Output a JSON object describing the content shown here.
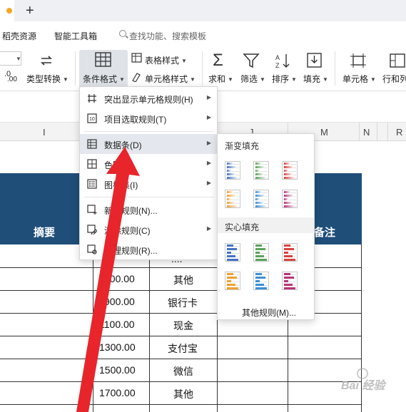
{
  "menu": {
    "item1": "稻壳资源",
    "item2": "智能工具箱",
    "search_placeholder": "查找功能、搜索模板"
  },
  "ribbon": {
    "left_value": ".0",
    "left_value2": ".00",
    "type_convert": "类型转换",
    "cond_format": "条件格式",
    "table_style": "表格样式",
    "cell_style": "单元格样式",
    "sum": "求和",
    "filter": "筛选",
    "sort": "排序",
    "fill": "填充",
    "cell": "单元格",
    "rows_cols": "行和列"
  },
  "columns": {
    "i": "I",
    "j": "J",
    "m": "M",
    "n": "N",
    "r": "R"
  },
  "sheet": {
    "header_summary": "摘要",
    "header_note": "备注",
    "rows": [
      {
        "amount": "",
        "method": "...."
      },
      {
        "amount": "700.00",
        "method": "其他"
      },
      {
        "amount": "900.00",
        "method": "银行卡"
      },
      {
        "amount": "1100.00",
        "method": "现金"
      },
      {
        "amount": "1300.00",
        "method": "支付宝"
      },
      {
        "amount": "1500.00",
        "method": "微信"
      },
      {
        "amount": "1700.00",
        "method": "其他"
      }
    ]
  },
  "dropdown": {
    "items": [
      {
        "label": "突出显示单元格规则(H)",
        "has_sub": true
      },
      {
        "label": "项目选取规则(T)",
        "has_sub": true
      },
      {
        "label": "数据条(D)",
        "has_sub": true
      },
      {
        "label": "色阶(S)",
        "has_sub": true
      },
      {
        "label": "图标集(I)",
        "has_sub": true
      },
      {
        "label": "新建规则(N)...",
        "has_sub": false
      },
      {
        "label": "清除规则(C)",
        "has_sub": true
      },
      {
        "label": "管理规则(R)...",
        "has_sub": false
      }
    ]
  },
  "submenu": {
    "gradient_title": "渐变填充",
    "solid_title": "实心填充",
    "more": "其他规则(M)...",
    "colors": [
      "#4472c4",
      "#5aa35a",
      "#d9433c",
      "#f0a030",
      "#3a8fd9",
      "#b8327a"
    ]
  },
  "watermark": "Bai 经验"
}
